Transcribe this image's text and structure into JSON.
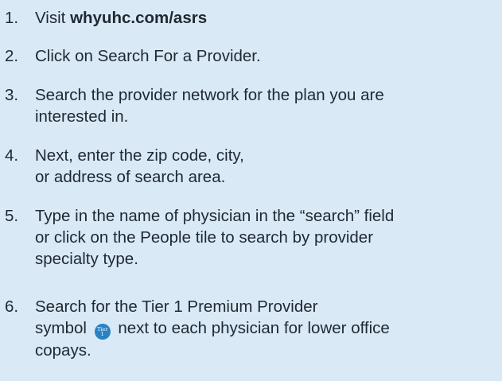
{
  "steps": [
    {
      "number": "1.",
      "text_prefix": "Visit ",
      "link": "whyuhc.com/asrs"
    },
    {
      "number": "2.",
      "text": "Click on Search For a Provider."
    },
    {
      "number": "3.",
      "line1": "Search the provider network for the plan you are",
      "line2": "interested in."
    },
    {
      "number": "4.",
      "line1": "Next, enter the zip code, city,",
      "line2": "or address of search area."
    },
    {
      "number": "5.",
      "line1": "Type in the name of physician in the “search” field",
      "line2": "or click on the People tile to search by provider",
      "line3": "specialty type."
    },
    {
      "number": "6.",
      "line1": "Search for the Tier 1 Premium Provider",
      "line2_before": "symbol",
      "line2_after": "next to each physician for lower office",
      "line3": "copays."
    }
  ],
  "tier_badge": {
    "top": "Tier",
    "bottom": "1",
    "color": "#2a82c4",
    "icon": "tier-1-premium-provider-icon"
  }
}
